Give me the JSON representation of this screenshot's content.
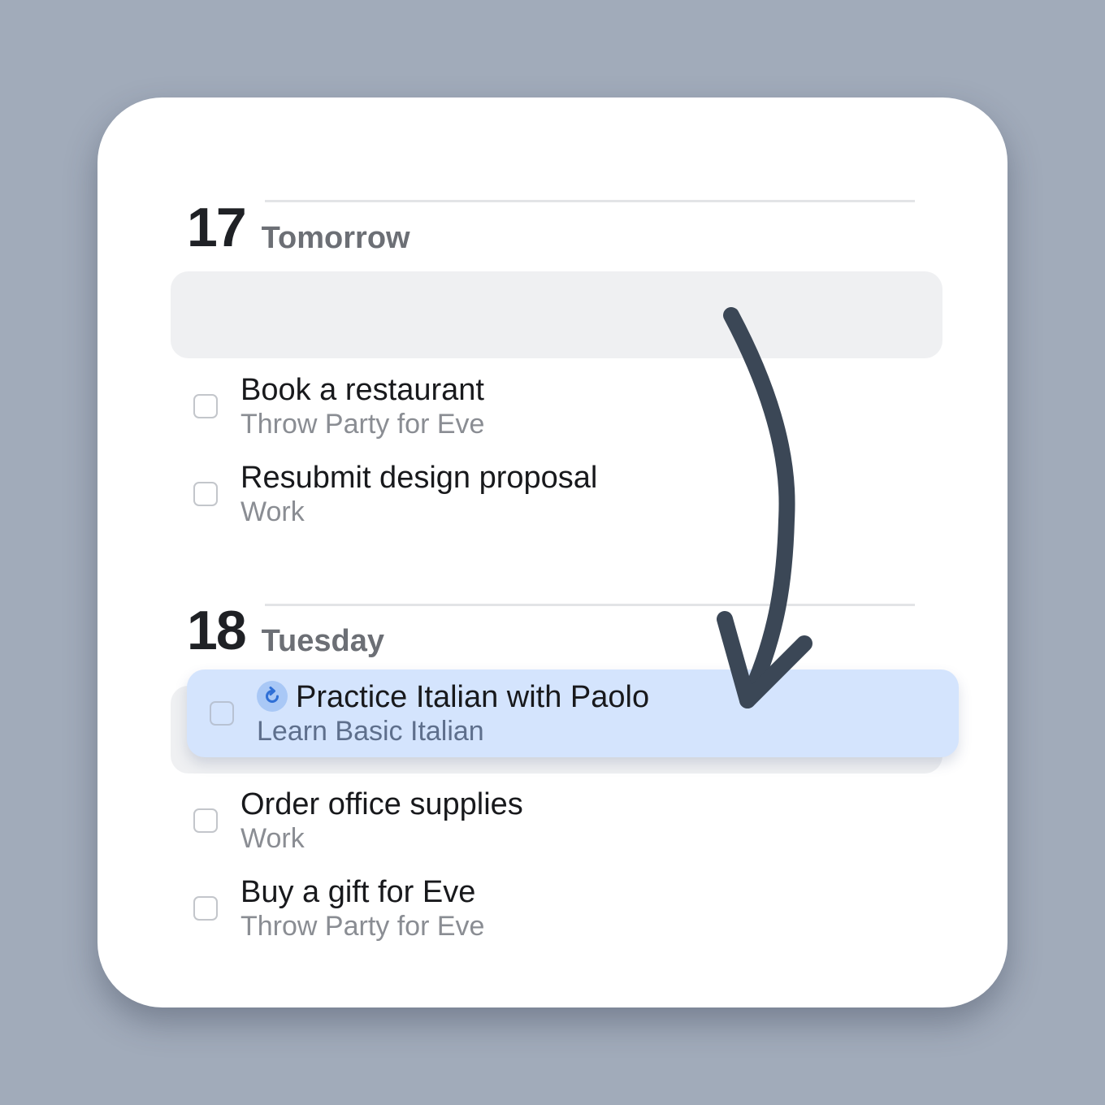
{
  "sections": [
    {
      "day_number": "17",
      "day_name": "Tomorrow",
      "tasks": [
        {
          "title": "Book a restaurant",
          "project": "Throw Party for Eve"
        },
        {
          "title": "Resubmit design proposal",
          "project": "Work"
        }
      ]
    },
    {
      "day_number": "18",
      "day_name": "Tuesday",
      "dragging_task": {
        "title": "Practice Italian with Paolo",
        "project": "Learn Basic Italian",
        "icon": "repeat-icon"
      },
      "tasks": [
        {
          "title": "Order office supplies",
          "project": "Work"
        },
        {
          "title": "Buy a gift for Eve",
          "project": "Throw Party for Eve"
        }
      ]
    }
  ],
  "colors": {
    "background": "#a1abba",
    "card": "#ffffff",
    "drag_highlight": "#d4e4fd",
    "accent_blue": "#2f6fd6",
    "arrow": "#3b4756"
  }
}
